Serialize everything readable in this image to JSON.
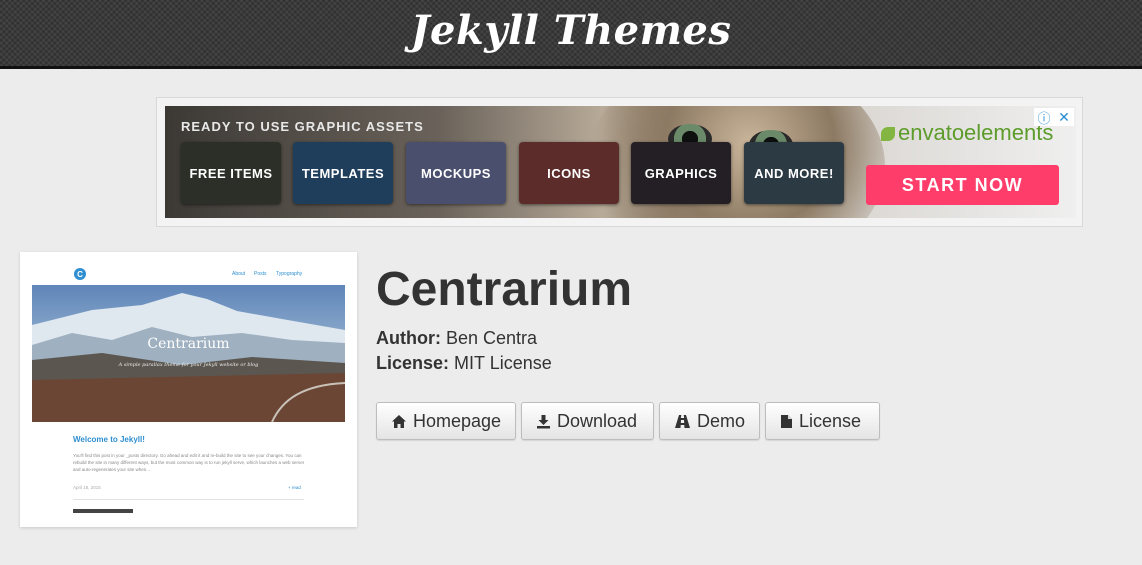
{
  "header": {
    "site_title": "Jekyll Themes"
  },
  "ad": {
    "heading": "READY TO USE GRAPHIC ASSETS",
    "tiles": [
      {
        "label": "FREE ITEMS",
        "color": "#2b2f28"
      },
      {
        "label": "TEMPLATES",
        "color": "#1f3e5c"
      },
      {
        "label": "MOCKUPS",
        "color": "#4a4f6e"
      },
      {
        "label": "ICONS",
        "color": "#5c2c2a"
      },
      {
        "label": "GRAPHICS",
        "color": "#231f25"
      },
      {
        "label": "AND MORE!",
        "color": "#2c3a44"
      }
    ],
    "brand": "envatoelements",
    "cta_label": "START NOW",
    "choice_icon": "info-icon",
    "close_icon": "close-icon",
    "cta_color": "#ff3d6a"
  },
  "thumbnail": {
    "nav_items": [
      "About",
      "Posts",
      "Typography"
    ],
    "hero_title": "Centrarium",
    "hero_subtitle": "A simple parallax theme for your Jekyll website or blog",
    "post_title": "Welcome to Jekyll!",
    "post_excerpt": "You'll find this post in your _posts directory. Go ahead and edit it and re-build the site to see your changes. You can rebuild the site in many different ways, but the most common way is to run jekyll serve, which launches a web server and auto-regenerates your site when...",
    "post_date": "April 18, 2015",
    "post_more": "+ read"
  },
  "theme": {
    "name": "Centrarium",
    "author_label": "Author:",
    "author": "Ben Centra",
    "license_label": "License:",
    "license": "MIT License"
  },
  "buttons": [
    {
      "label": "Homepage",
      "icon": "home-icon"
    },
    {
      "label": "Download",
      "icon": "download-icon"
    },
    {
      "label": "Demo",
      "icon": "road-icon"
    },
    {
      "label": "License",
      "icon": "file-icon"
    }
  ]
}
